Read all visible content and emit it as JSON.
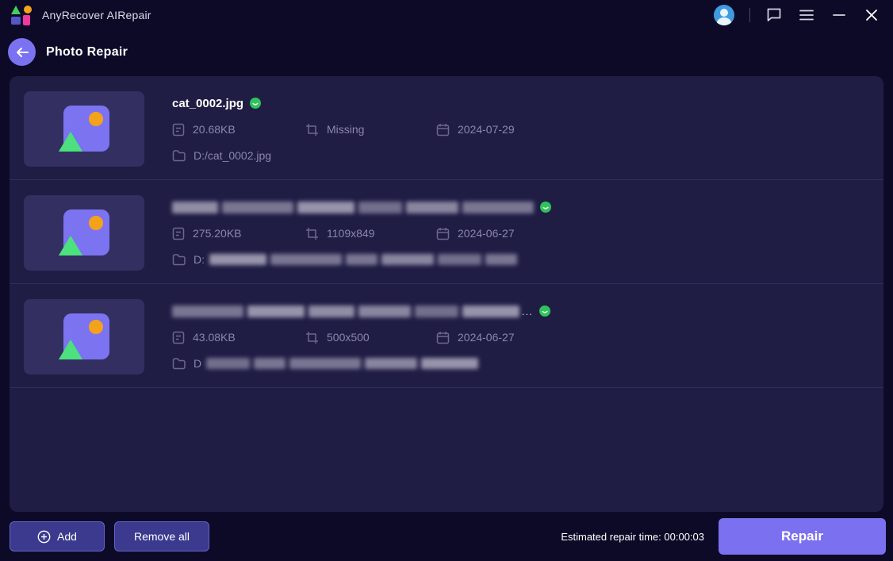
{
  "titlebar": {
    "app_title": "AnyRecover AIRepair",
    "icons": [
      "app-logo",
      "user-avatar",
      "chat-icon",
      "menu-icon",
      "minimize-button",
      "close-button"
    ]
  },
  "header": {
    "title": "Photo Repair"
  },
  "files": [
    {
      "name": "cat_0002.jpg",
      "name_redacted": false,
      "status": "ok",
      "size": "20.68KB",
      "dimensions": "Missing",
      "date": "2024-07-29",
      "path": "D:/cat_0002.jpg",
      "path_redacted": false
    },
    {
      "name": "",
      "name_redacted": true,
      "status": "ok",
      "size": "275.20KB",
      "dimensions": "1109x849",
      "date": "2024-06-27",
      "path": "D:",
      "path_redacted": true
    },
    {
      "name": "",
      "name_redacted": true,
      "status": "ok",
      "size": "43.08KB",
      "dimensions": "500x500",
      "date": "2024-06-27",
      "path": "D",
      "path_redacted": true
    }
  ],
  "footer": {
    "add_label": "Add",
    "remove_all_label": "Remove all",
    "estimated_prefix": "Estimated repair time:",
    "estimated_value": "00:00:03",
    "repair_label": "Repair"
  },
  "colors": {
    "window_bg": "#0d0a28",
    "panel_bg": "#201d45",
    "accent_purple": "#7b70f0",
    "thumb_bg": "#332f61",
    "status_green": "#2fc25b",
    "logo_green": "#3fd05e",
    "logo_orange": "#f5a21b",
    "logo_pink": "#f0399d",
    "logo_blue": "#5556c8",
    "secondary_text": "#8a86ad",
    "avatar_blue": "#3f9be0",
    "button_secondary_bg": "#3b3a8e",
    "button_secondary_border": "#6663c9"
  }
}
